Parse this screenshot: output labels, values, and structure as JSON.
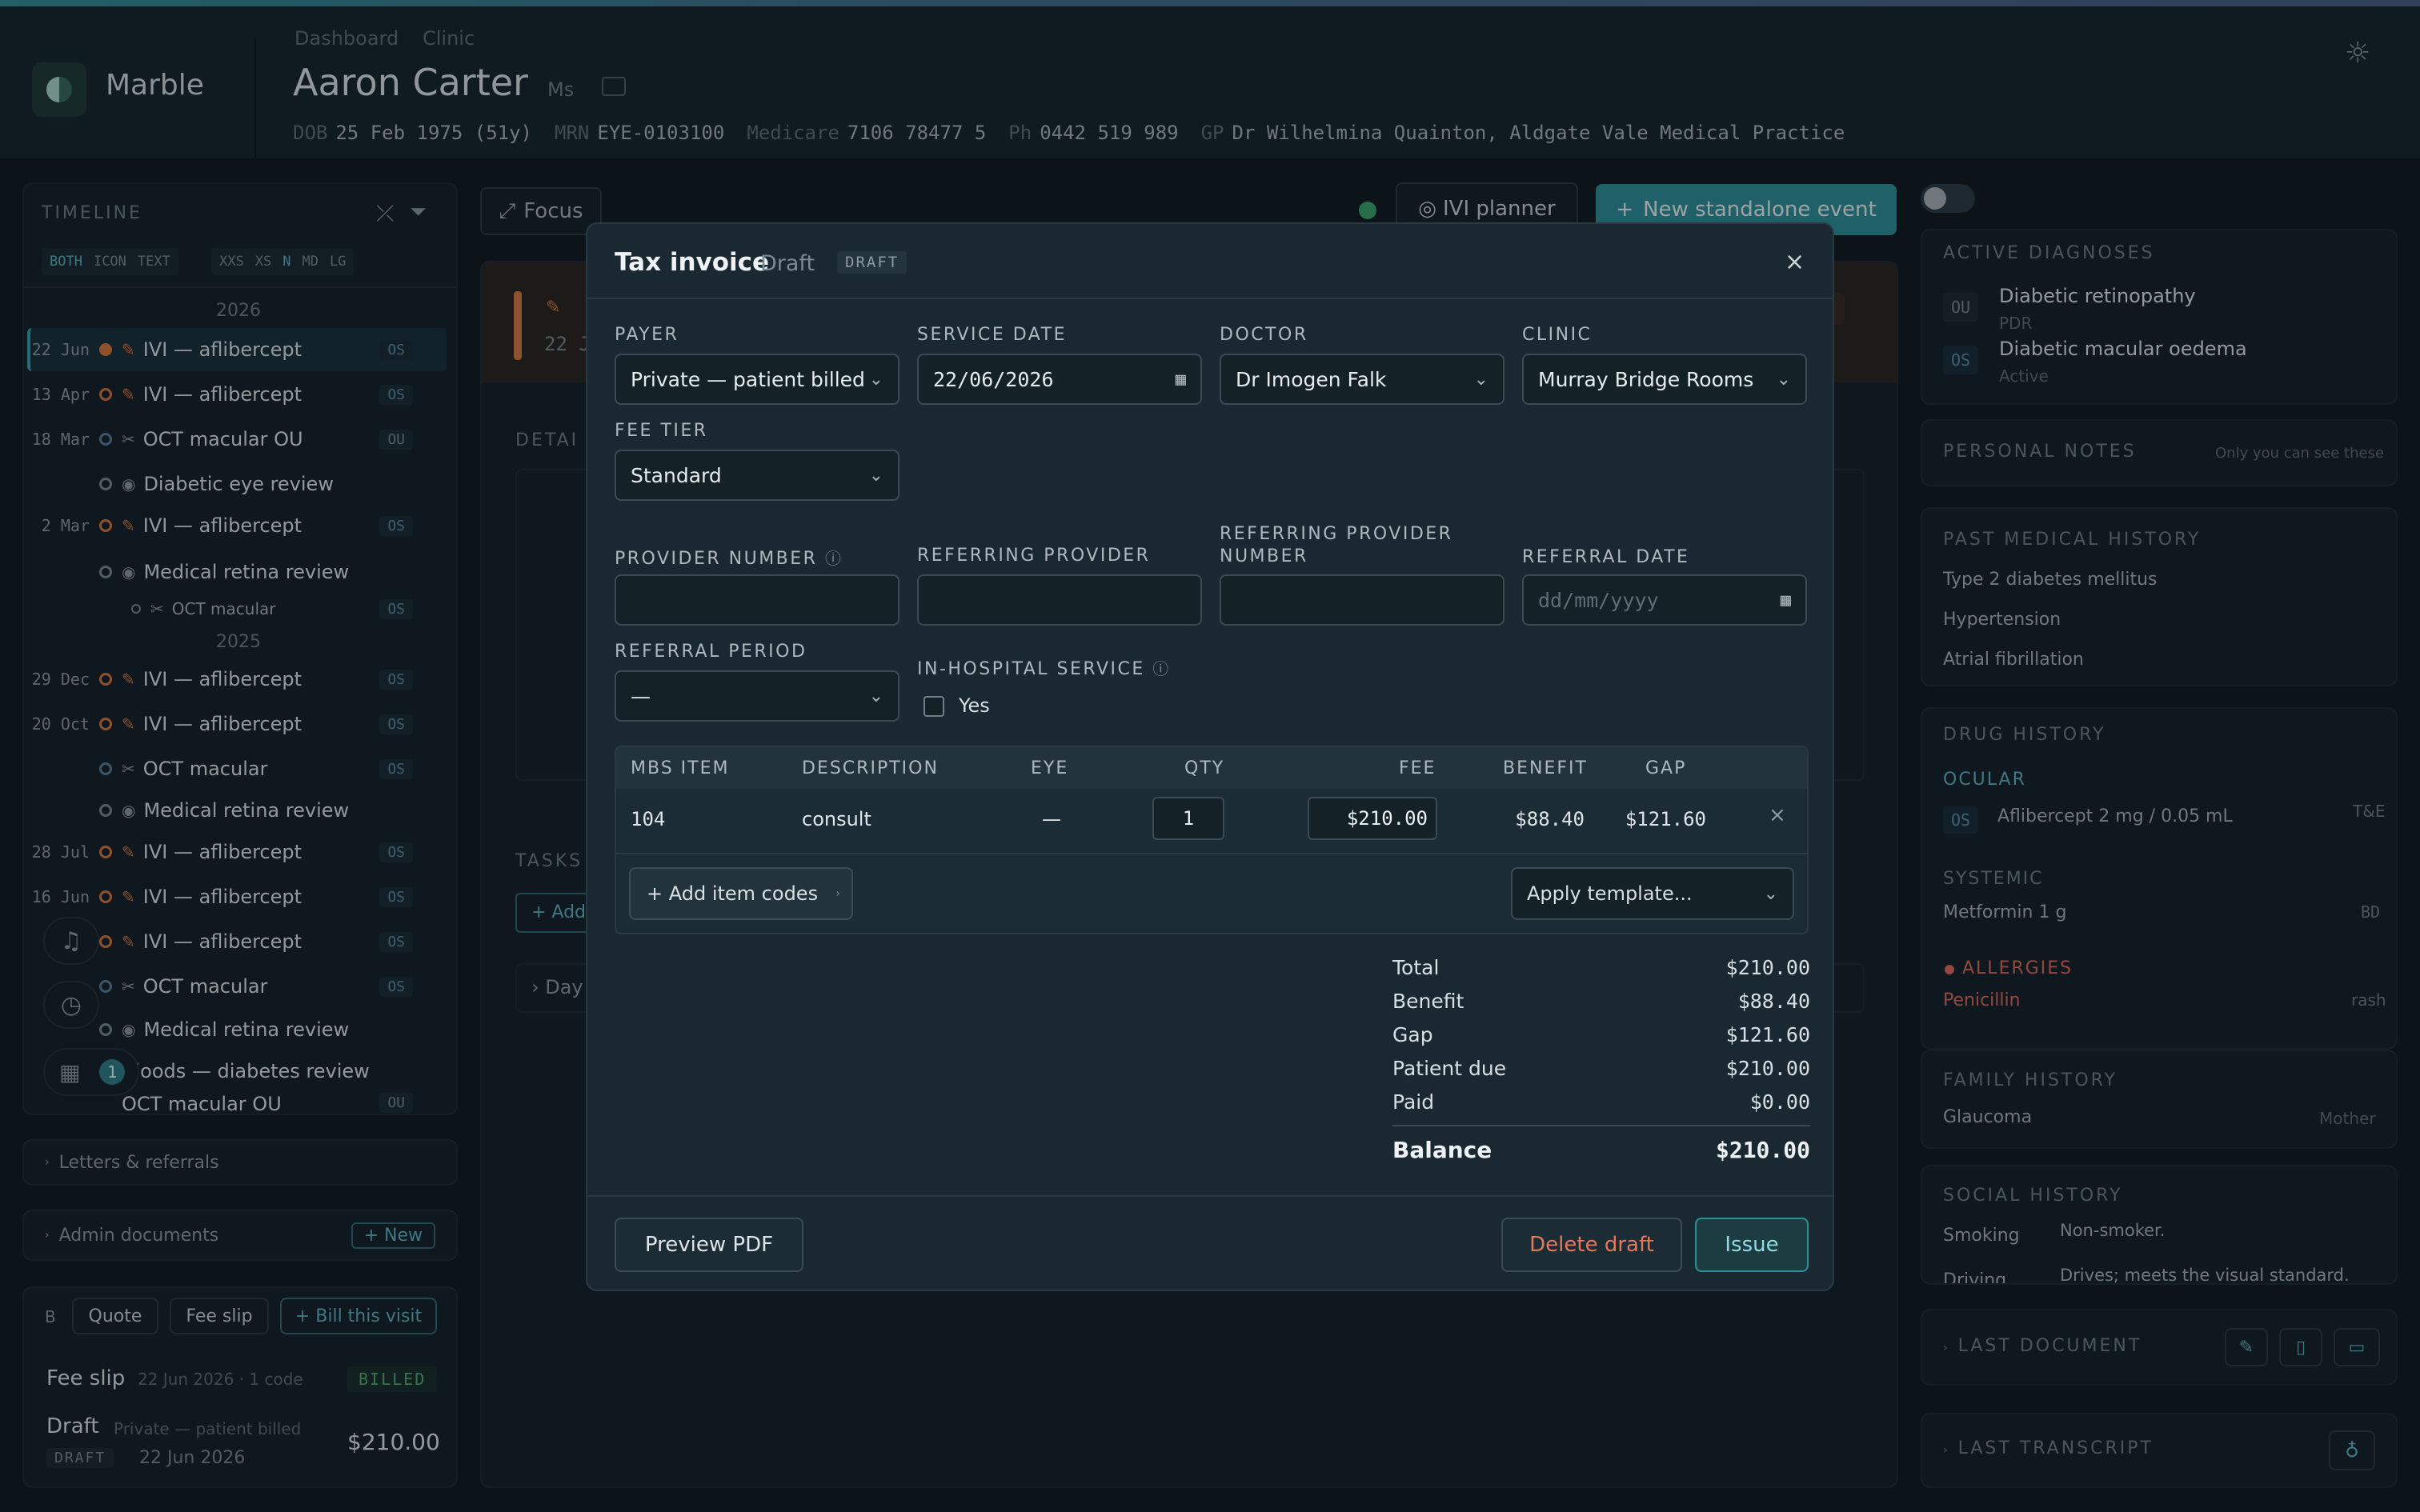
{
  "header": {
    "app_name": "Marble",
    "breadcrumbs": [
      "Dashboard",
      "Clinic"
    ],
    "patient_name": "Aaron Carter",
    "patient_title": "Ms",
    "dob_label": "DOB",
    "dob": "25 Feb 1975 (51y)",
    "mrn_label": "MRN",
    "mrn": "EYE-0103100",
    "medicare_label": "Medicare",
    "medicare": "7106 78477 5",
    "ph_label": "Ph",
    "ph": "0442 519 989",
    "gp_label": "GP",
    "gp": "Dr Wilhelmina Quainton, Aldgate Vale Medical Practice"
  },
  "timeline": {
    "title": "TIMELINE",
    "mode_options": [
      "BOTH",
      "ICON",
      "TEXT"
    ],
    "size_options": [
      "XXS",
      "XS",
      "N",
      "MD",
      "LG"
    ],
    "year_2026": "2026",
    "year_2025": "2025",
    "items": [
      {
        "date": "22 Jun",
        "title": "IVI — aflibercept",
        "eye": "OS"
      },
      {
        "date": "13 Apr",
        "title": "IVI — aflibercept",
        "eye": "OS"
      },
      {
        "date": "18 Mar",
        "title": "OCT macular OU",
        "eye": "OU"
      },
      {
        "date": "",
        "title": "Diabetic eye review",
        "eye": ""
      },
      {
        "date": "2 Mar",
        "title": "IVI — aflibercept",
        "eye": "OS"
      },
      {
        "date": "",
        "title": "Medical retina review",
        "eye": ""
      },
      {
        "date": "",
        "title": "OCT macular",
        "eye": "OS"
      },
      {
        "date": "29 Dec",
        "title": "IVI — aflibercept",
        "eye": "OS"
      },
      {
        "date": "20 Oct",
        "title": "IVI — aflibercept",
        "eye": "OS"
      },
      {
        "date": "",
        "title": "OCT macular",
        "eye": "OS"
      },
      {
        "date": "",
        "title": "Medical retina review",
        "eye": ""
      },
      {
        "date": "28 Jul",
        "title": "IVI — aflibercept",
        "eye": "OS"
      },
      {
        "date": "16 Jun",
        "title": "IVI — aflibercept",
        "eye": "OS"
      },
      {
        "date": "",
        "title": "IVI — aflibercept",
        "eye": "OS"
      },
      {
        "date": "",
        "title": "OCT macular",
        "eye": "OS"
      },
      {
        "date": "",
        "title": "Medical retina review",
        "eye": ""
      },
      {
        "date": "",
        "title": "Bloods — diabetes review",
        "eye": ""
      },
      {
        "date": "",
        "title": "OCT macular OU",
        "eye": "OU"
      }
    ],
    "notification_count": "1"
  },
  "left_sections": {
    "letters": "Letters & referrals",
    "admin_docs": "Admin documents",
    "admin_new": "+ New",
    "billing_prefix": "B",
    "quote": "Quote",
    "fee_slip_btn": "Fee slip",
    "bill_visit": "+ Bill this visit",
    "fee_slip_title": "Fee slip",
    "fee_slip_meta": "22 Jun 2026 · 1 code",
    "fee_slip_badge": "BILLED",
    "draft_title": "Draft",
    "draft_meta": "Private — patient billed",
    "draft_badge": "DRAFT",
    "draft_date": "22 Jun 2026",
    "draft_amount": "$210.00"
  },
  "center": {
    "focus": "Focus",
    "ivi_planner": "IVI planner",
    "new_event": "New standalone event",
    "details_label": "DETAI",
    "tasks_label": "TASKS",
    "add_label": "+ Add",
    "day_label": "› Day",
    "event_date_fragment": "22 J",
    "pill_fragment": "e"
  },
  "modal": {
    "title": "Tax invoice",
    "subtitle": "Draft",
    "badge": "DRAFT",
    "payer_label": "PAYER",
    "payer": "Private — patient billed",
    "service_date_label": "SERVICE DATE",
    "service_date": "22/06/2026",
    "doctor_label": "DOCTOR",
    "doctor": "Dr Imogen Falk",
    "clinic_label": "CLINIC",
    "clinic": "Murray Bridge Rooms",
    "fee_tier_label": "FEE TIER",
    "fee_tier": "Standard",
    "provider_number_label": "PROVIDER NUMBER",
    "referring_provider_label": "REFERRING PROVIDER",
    "referring_provider_number_label_1": "REFERRING PROVIDER",
    "referring_provider_number_label_2": "NUMBER",
    "referral_date_label": "REFERRAL DATE",
    "referral_date_placeholder": "dd/mm/yyyy",
    "referral_period_label": "REFERRAL PERIOD",
    "referral_period": "—",
    "in_hospital_label": "IN-HOSPITAL SERVICE",
    "in_hospital_yes": "Yes",
    "columns": [
      "MBS ITEM",
      "DESCRIPTION",
      "EYE",
      "QTY",
      "FEE",
      "BENEFIT",
      "GAP"
    ],
    "rows": [
      {
        "item": "104",
        "description": "consult",
        "eye": "—",
        "qty": "1",
        "fee": "$210.00",
        "benefit": "$88.40",
        "gap": "$121.60"
      }
    ],
    "add_item_codes": "+ Add item codes",
    "apply_template": "Apply template...",
    "summary": [
      {
        "label": "Total",
        "value": "$210.00"
      },
      {
        "label": "Benefit",
        "value": "$88.40"
      },
      {
        "label": "Gap",
        "value": "$121.60"
      },
      {
        "label": "Patient due",
        "value": "$210.00"
      },
      {
        "label": "Paid",
        "value": "$0.00"
      }
    ],
    "balance_label": "Balance",
    "balance": "$210.00",
    "preview_pdf": "Preview PDF",
    "delete_draft": "Delete draft",
    "issue": "Issue"
  },
  "right": {
    "active_diagnoses": "ACTIVE DIAGNOSES",
    "diagnoses": [
      {
        "eye": "OU",
        "name": "Diabetic retinopathy",
        "sub": "PDR"
      },
      {
        "eye": "OS",
        "name": "Diabetic macular oedema",
        "sub": "Active"
      }
    ],
    "personal_notes": "PERSONAL NOTES",
    "personal_notes_hint": "Only you can see these",
    "pmh_title": "PAST MEDICAL HISTORY",
    "pmh": [
      "Type 2 diabetes mellitus",
      "Hypertension",
      "Atrial fibrillation"
    ],
    "drug_history": "DRUG HISTORY",
    "ocular": "OCULAR",
    "ocular_eye": "OS",
    "ocular_drug": "Aflibercept 2 mg / 0.05 mL",
    "ocular_freq": "T&E",
    "systemic": "SYSTEMIC",
    "systemic_drug": "Metformin 1 g",
    "systemic_freq": "BD",
    "allergies": "ALLERGIES",
    "allergy": "Penicillin",
    "allergy_reaction": "rash",
    "family_history": "FAMILY HISTORY",
    "fh_item": "Glaucoma",
    "fh_relation": "Mother",
    "social_history": "SOCIAL HISTORY",
    "sh_smoking_label": "Smoking",
    "sh_smoking": "Non-smoker.",
    "sh_driving_label": "Driving",
    "sh_driving": "Drives; meets the visual standard.",
    "last_document": "LAST DOCUMENT",
    "last_transcript": "LAST TRANSCRIPT"
  }
}
